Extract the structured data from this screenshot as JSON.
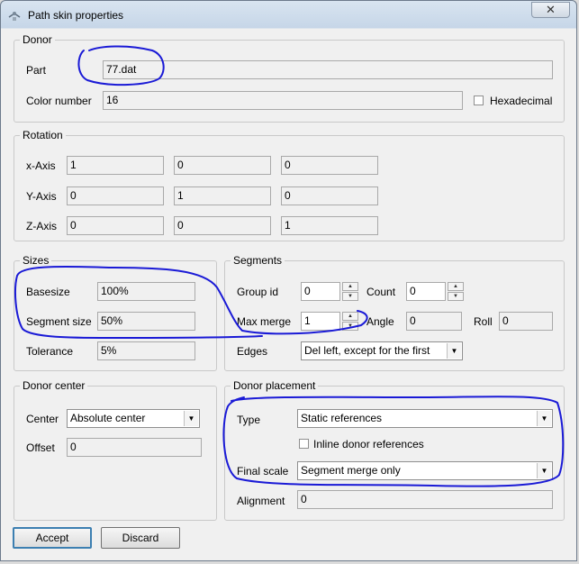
{
  "window": {
    "title": "Path skin properties",
    "close_glyph": "✕"
  },
  "donor": {
    "legend": "Donor",
    "part_label": "Part",
    "part_value": "77.dat",
    "color_label": "Color number",
    "color_value": "16",
    "hex_label": "Hexadecimal",
    "hex_checked": false
  },
  "rotation": {
    "legend": "Rotation",
    "rows": [
      {
        "label": "x-Axis",
        "values": [
          "1",
          "0",
          "0"
        ]
      },
      {
        "label": "Y-Axis",
        "values": [
          "0",
          "1",
          "0"
        ]
      },
      {
        "label": "Z-Axis",
        "values": [
          "0",
          "0",
          "1"
        ]
      }
    ]
  },
  "sizes": {
    "legend": "Sizes",
    "basesize_label": "Basesize",
    "basesize_value": "100%",
    "segsize_label": "Segment size",
    "segsize_value": "50%",
    "tolerance_label": "Tolerance",
    "tolerance_value": "5%"
  },
  "segments": {
    "legend": "Segments",
    "group_label": "Group id",
    "group_value": "0",
    "count_label": "Count",
    "count_value": "0",
    "maxmerge_label": "Max merge",
    "maxmerge_value": "1",
    "angle_label": "Angle",
    "angle_value": "0",
    "roll_label": "Roll",
    "roll_value": "0",
    "edges_label": "Edges",
    "edges_value": "Del left, except for the first"
  },
  "donor_center": {
    "legend": "Donor center",
    "center_label": "Center",
    "center_value": "Absolute center",
    "offset_label": "Offset",
    "offset_value": "0"
  },
  "donor_placement": {
    "legend": "Donor placement",
    "type_label": "Type",
    "type_value": "Static references",
    "inline_label": "Inline donor references",
    "inline_checked": false,
    "final_label": "Final scale",
    "final_value": "Segment merge only",
    "align_label": "Alignment",
    "align_value": "0"
  },
  "buttons": {
    "accept": "Accept",
    "discard": "Discard"
  },
  "colors": {
    "annotation": "#1a1ad6",
    "default_button_border": "#3c7fb1"
  }
}
